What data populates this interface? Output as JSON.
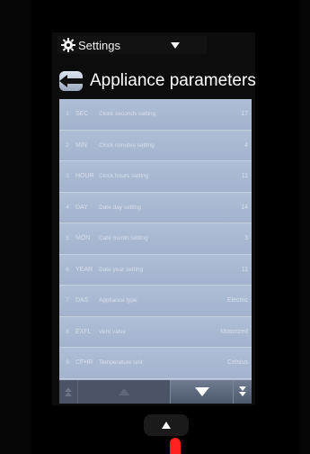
{
  "header": {
    "dropdown_label": "Settings",
    "gear_icon": "gear-icon",
    "chevron_icon": "chevron-down-icon"
  },
  "title_bar": {
    "back_icon": "back-arrow-icon",
    "title": "Appliance parameters"
  },
  "parameters": [
    {
      "num": "1",
      "code": "SEC",
      "desc": "Clock seconds setting",
      "value": "17"
    },
    {
      "num": "2",
      "code": "MIN",
      "desc": "Clock minutes setting",
      "value": "4"
    },
    {
      "num": "3",
      "code": "HOUR",
      "desc": "Clock hours setting",
      "value": "11"
    },
    {
      "num": "4",
      "code": "DAY",
      "desc": "Date day setting",
      "value": "14"
    },
    {
      "num": "5",
      "code": "MON",
      "desc": "Date month setting",
      "value": "3"
    },
    {
      "num": "6",
      "code": "YEAR",
      "desc": "Date year setting",
      "value": "11"
    },
    {
      "num": "7",
      "code": "DAS",
      "desc": "Appliance type",
      "value": "Electric"
    },
    {
      "num": "8",
      "code": "EXFL",
      "desc": "Vent valve",
      "value": "Motorized"
    },
    {
      "num": "9",
      "code": "CFHR",
      "desc": "Temperature unit",
      "value": "Celsius"
    }
  ],
  "bottom_bar": {
    "icons": [
      "scroll-top-icon",
      "scroll-up-icon",
      "scroll-down-icon",
      "scroll-bottom-icon"
    ]
  },
  "home_button": {
    "icon": "up-arrow-icon"
  }
}
